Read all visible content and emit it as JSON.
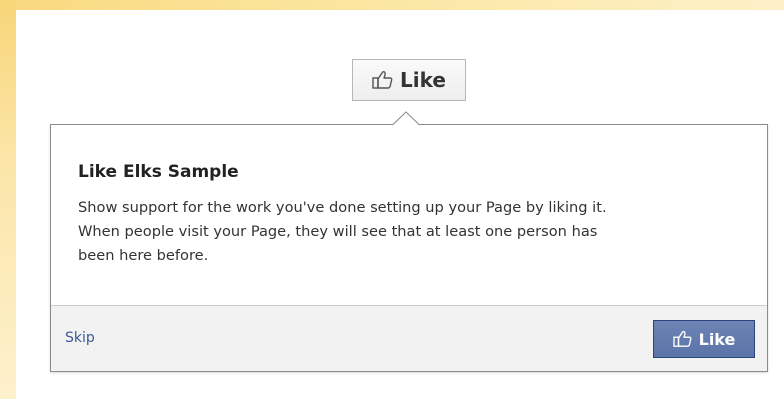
{
  "top_button": {
    "label": "Like",
    "icon": "thumbs-up-icon"
  },
  "popover": {
    "title": "Like Elks Sample",
    "body_lines": [
      "Show support for the work you've done setting up your Page by liking it.",
      "When people visit your Page, they will see that at least one person has",
      "been here before."
    ],
    "skip_label": "Skip",
    "like_label": "Like",
    "like_icon": "thumbs-up-icon"
  },
  "colors": {
    "background_gold": "#fbe7b0",
    "link_blue": "#3b5998",
    "button_blue": "#5b74a8",
    "footer_gray": "#f2f2f2"
  }
}
